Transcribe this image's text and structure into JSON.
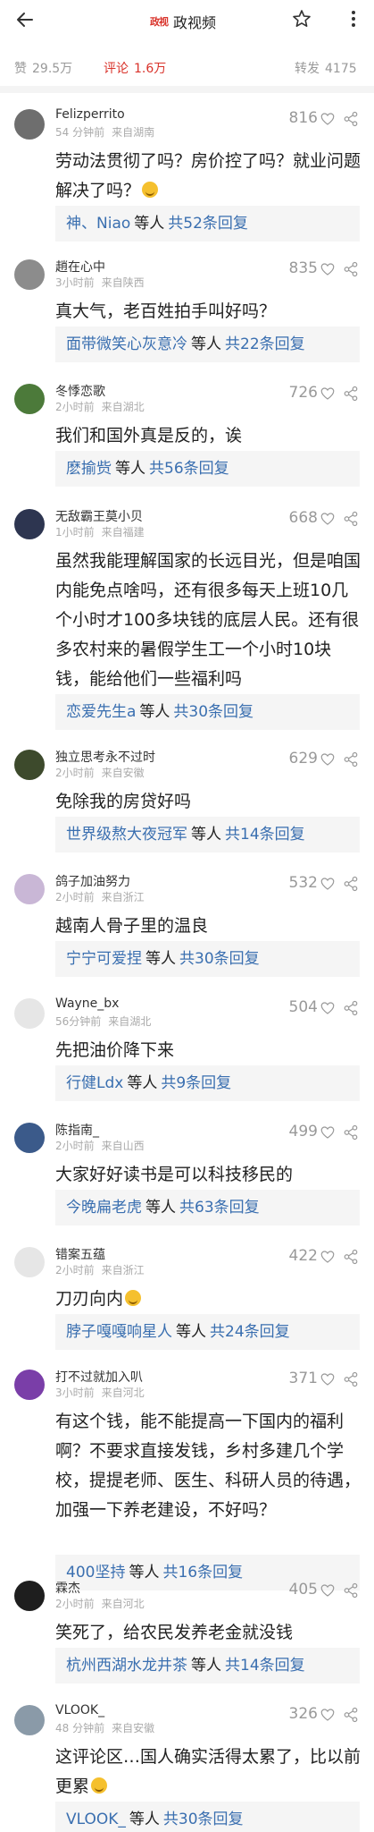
{
  "header": {
    "logo_text": "政视",
    "title": "政视频"
  },
  "stats": {
    "like_label": "赞",
    "like_count": "29.5万",
    "comment_label": "评论",
    "comment_count": "1.6万",
    "share_label": "转发",
    "share_count": "4175"
  },
  "colors": {
    "accent": "#d9332b",
    "link": "#3a6fb0",
    "reply_bg": "#f5f5f5"
  },
  "icons": [
    "back-arrow-icon",
    "star-icon",
    "more-vertical-icon",
    "heart-outline-icon",
    "share-icon"
  ],
  "comments": [
    {
      "user": "Felizperrito",
      "time": "54 分钟前",
      "loc": "来自湖南",
      "likes": "816",
      "text": "劳动法贯彻了吗？房价控了吗？就业问题解决了吗？",
      "emoji": true,
      "reply_users": "神、Niao",
      "reply_etal": "等人",
      "reply_count": "共52条回复",
      "avatar_color": "#6e6e6e"
    },
    {
      "user": "趙在心中",
      "time": "3小时前",
      "loc": "来自陕西",
      "likes": "835",
      "text": "真大气，老百姓拍手叫好吗？",
      "emoji": false,
      "reply_users": "面带微笑心灰意冷",
      "reply_etal": "等人",
      "reply_count": "共22条回复",
      "avatar_color": "#8c8c8c"
    },
    {
      "user": "冬悸恋歌",
      "time": "2小时前",
      "loc": "来自湖北",
      "likes": "726",
      "text": "我们和国外真是反的，诶",
      "emoji": false,
      "reply_users": "麽揄赀",
      "reply_etal": "等人",
      "reply_count": "共56条回复",
      "avatar_color": "#4c7a3a"
    },
    {
      "user": "无敌霸王莫小贝",
      "time": "1小时前",
      "loc": "来自福建",
      "likes": "668",
      "text": "虽然我能理解国家的长远目光，但是咱国内能免点啥吗，还有很多每天上班10几个小时才100多块钱的底层人民。还有很多农村来的暑假学生工一个小时10块钱，能给他们一些福利吗",
      "emoji": false,
      "reply_users": "恋爱先生a",
      "reply_etal": "等人",
      "reply_count": "共30条回复",
      "avatar_color": "#2d3550"
    },
    {
      "user": "独立思考永不过时",
      "time": "2小时前",
      "loc": "来自安徽",
      "likes": "629",
      "text": "免除我的房贷好吗",
      "emoji": false,
      "reply_users": "世界级熬大夜冠军",
      "reply_etal": "等人",
      "reply_count": "共14条回复",
      "avatar_color": "#3d4a2c"
    },
    {
      "user": "鸽子加油努力",
      "time": "2小时前",
      "loc": "来自浙江",
      "likes": "532",
      "text": "越南人骨子里的温良",
      "emoji": false,
      "reply_users": "宁宁可爱捏",
      "reply_etal": "等人",
      "reply_count": "共30条回复",
      "avatar_color": "#c9b7d6"
    },
    {
      "user": "Wayne_bx",
      "time": "56分钟前",
      "loc": "来自湖北",
      "likes": "504",
      "text": "先把油价降下来",
      "emoji": false,
      "reply_users": "行健Ldx",
      "reply_etal": "等人",
      "reply_count": "共9条回复",
      "avatar_color": "#e6e6e6"
    },
    {
      "user": "陈指南_",
      "time": "2小时前",
      "loc": "来自山西",
      "likes": "499",
      "text": "大家好好读书是可以科技移民的",
      "emoji": false,
      "reply_users": "今晚扁老虎",
      "reply_etal": "等人",
      "reply_count": "共63条回复",
      "avatar_color": "#3b5a8a"
    },
    {
      "user": "错案五蕴",
      "time": "2小时前",
      "loc": "来自浙江",
      "likes": "422",
      "text": "刀刃向内",
      "emoji": true,
      "reply_users": "脖子嘎嘎响星人",
      "reply_etal": "等人",
      "reply_count": "共24条回复",
      "avatar_color": "#e6e6e6"
    },
    {
      "user": "打不过就加入叭",
      "time": "3小时前",
      "loc": "来自河北",
      "likes": "371",
      "text": "有这个钱，能不能提高一下国内的福利啊？不要求直接发钱，乡村多建几个学校，提提老师、医生、科研人员的待遇，加强一下养老建设，不好吗？",
      "emoji": false,
      "reply_users": "400坚持",
      "reply_etal": "等人",
      "reply_count": "共16条回复",
      "avatar_color": "#7a3ea8"
    },
    {
      "user": "霖杰",
      "time": "2小时前",
      "loc": "来自河北",
      "likes": "405",
      "text": "笑死了，给农民发养老金就没钱",
      "emoji": false,
      "reply_users": "杭州西湖水龙井茶",
      "reply_etal": "等人",
      "reply_count": "共14条回复",
      "avatar_color": "#1e1e1e"
    },
    {
      "user": "VLOOK_",
      "time": "48 分钟前",
      "loc": "来自安徽",
      "likes": "326",
      "text": "这评论区…国人确实活得太累了，比以前更累",
      "emoji": true,
      "reply_users": "VLOOK_",
      "reply_etal": "等人",
      "reply_count": "共30条回复",
      "avatar_color": "#8a9aa8"
    }
  ]
}
